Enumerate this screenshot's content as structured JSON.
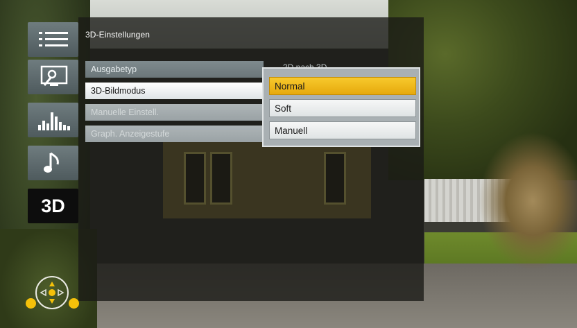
{
  "panel": {
    "title": "3D-Einstellungen"
  },
  "sidebar": {
    "items": [
      {
        "name": "menu-list",
        "icon": "list-icon"
      },
      {
        "name": "settings",
        "icon": "monitor-wrench-icon"
      },
      {
        "name": "equalizer",
        "icon": "equalizer-icon"
      },
      {
        "name": "music",
        "icon": "music-note-icon"
      },
      {
        "name": "3d",
        "label": "3D",
        "active": true
      }
    ]
  },
  "menu": {
    "items": [
      {
        "label": "Ausgabetyp",
        "state": "enabled"
      },
      {
        "label": "3D-Bildmodus",
        "state": "selected"
      },
      {
        "label": "Manuelle Einstell.",
        "state": "disabled"
      },
      {
        "label": "Graph. Anzeigestufe",
        "state": "disabled"
      }
    ],
    "partial_value": "2D nach 3D"
  },
  "dropdown": {
    "options": [
      "Normal",
      "Soft",
      "Manuell"
    ],
    "highlighted": "Normal"
  },
  "colors": {
    "highlight": "#f2bd1f",
    "accent_dot": "#f5c10a"
  },
  "nav": {
    "icon": "directional-pad-icon"
  }
}
